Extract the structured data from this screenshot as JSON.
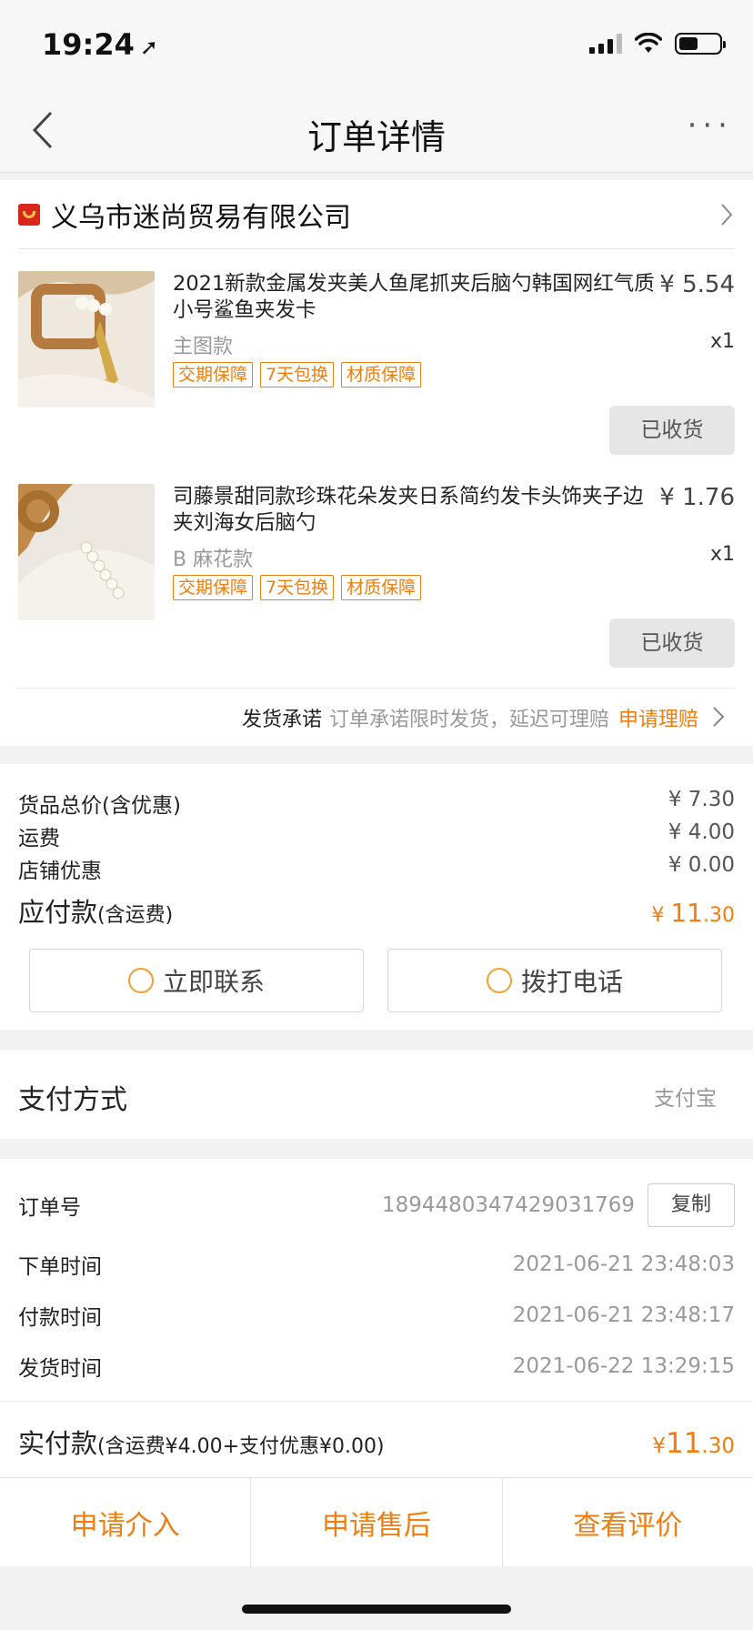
{
  "status": {
    "time": "19:24"
  },
  "nav": {
    "title": "订单详情",
    "more": "···"
  },
  "shop": {
    "name": "义乌市迷尚贸易有限公司"
  },
  "products": [
    {
      "title": "2021新款金属发夹美人鱼尾抓夹后脑勺韩国网红气质小号鲨鱼夹发卡",
      "price": "¥ 5.54",
      "variant": "主图款",
      "qty": "x1",
      "tags": [
        "交期保障",
        "7天包换",
        "材质保障"
      ],
      "status": "已收货"
    },
    {
      "title": "司藤景甜同款珍珠花朵发夹日系简约发卡头饰夹子边夹刘海女后脑勺",
      "price": "¥ 1.76",
      "variant": "B 麻花款",
      "qty": "x1",
      "tags": [
        "交期保障",
        "7天包换",
        "材质保障"
      ],
      "status": "已收货"
    }
  ],
  "promise": {
    "label": "发货承诺",
    "desc": "订单承诺限时发货，延迟可理赔",
    "link": "申请理赔"
  },
  "summary": {
    "goods_label": "货品总价(含优惠)",
    "goods_value": "¥ 7.30",
    "shipping_label": "运费",
    "shipping_value": "¥ 4.00",
    "discount_label": "店铺优惠",
    "discount_value": "¥ 0.00",
    "due_label": "应付款",
    "due_note": "(含运费)",
    "due_prefix": "¥ ",
    "due_int": "11",
    "due_dec": ".30"
  },
  "actions": {
    "contact": "立即联系",
    "call": "拨打电话"
  },
  "payment": {
    "label": "支付方式",
    "value": "支付宝"
  },
  "order": {
    "id_label": "订单号",
    "id_value": "1894480347429031769",
    "copy": "复制",
    "created_label": "下单时间",
    "created_value": "2021-06-21 23:48:03",
    "paid_label": "付款时间",
    "paid_value": "2021-06-21 23:48:17",
    "shipped_label": "发货时间",
    "shipped_value": "2021-06-22 13:29:15"
  },
  "paid": {
    "label": "实付款",
    "note": "(含运费¥4.00+支付优惠¥0.00)",
    "prefix": "¥",
    "int": "11",
    "dec": ".30"
  },
  "bottom": {
    "intervene": "申请介入",
    "aftersale": "申请售后",
    "review": "查看评价"
  },
  "colors": {
    "accent": "#f07d0d",
    "shop_icon": "#d9261c"
  }
}
